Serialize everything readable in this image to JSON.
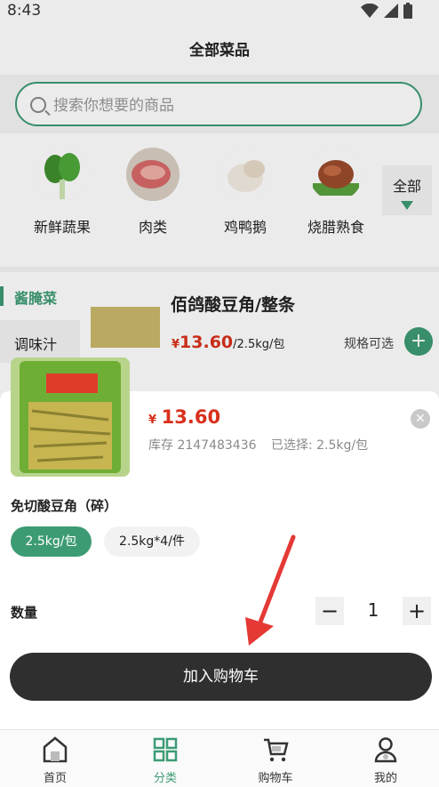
{
  "status": {
    "time": "8:43"
  },
  "page": {
    "title": "全部菜品"
  },
  "search": {
    "placeholder": "搜索你想要的商品"
  },
  "categories": [
    {
      "label": "新鲜蔬果"
    },
    {
      "label": "肉类"
    },
    {
      "label": "鸡鸭鹅"
    },
    {
      "label": "烧腊熟食"
    }
  ],
  "all_tab": {
    "label": "全部"
  },
  "sidebar": {
    "items": [
      "酱腌菜",
      "调味汁"
    ]
  },
  "product": {
    "name": "佰鸽酸豆角/整条",
    "currency": "¥",
    "price": "13.60",
    "unit": "/2.5kg/包",
    "spec_hint": "规格可选"
  },
  "sheet": {
    "currency": "¥",
    "price": "13.60",
    "stock": "库存 2147483436",
    "selected": "已选择: 2.5kg/包",
    "spec_title": "免切酸豆角（碎）",
    "options": [
      "2.5kg/包",
      "2.5kg*4/件"
    ],
    "quantity_label": "数量",
    "quantity": "1",
    "add_to_cart": "加入购物车",
    "accent": "#3d9b74",
    "price_color": "#d9301c"
  },
  "tabbar": {
    "items": [
      "首页",
      "分类",
      "购物车",
      "我的"
    ],
    "active_color": "#3d9b74"
  }
}
